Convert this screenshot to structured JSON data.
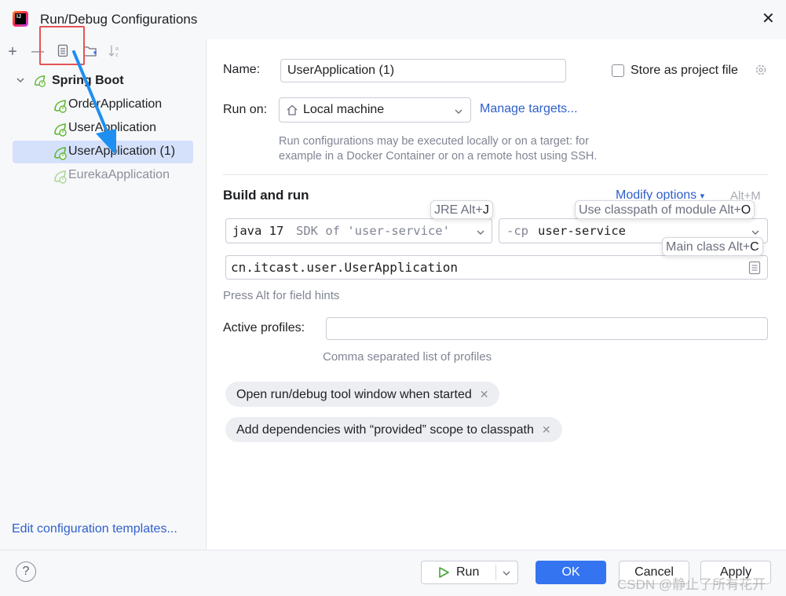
{
  "window": {
    "title": "Run/Debug Configurations",
    "close": "✕"
  },
  "toolbar": {
    "add": "+",
    "remove": "—",
    "copy": "▤",
    "folder": "🗀",
    "sort": "↓ᵃ"
  },
  "tree": {
    "group_label": "Spring Boot",
    "items": [
      {
        "label": "OrderApplication"
      },
      {
        "label": "UserApplication"
      },
      {
        "label": "UserApplication (1)"
      },
      {
        "label": "EurekaApplication"
      }
    ]
  },
  "left_footer": {
    "templates_link": "Edit configuration templates..."
  },
  "form": {
    "name_label": "Name:",
    "name_value": "UserApplication (1)",
    "store_label": "Store as project file",
    "run_on_label": "Run on:",
    "run_on_value": "Local machine",
    "manage_targets": "Manage targets...",
    "run_on_hint_1": "Run configurations may be executed locally or on a target: for",
    "run_on_hint_2": "example in a Docker Container or on a remote host using SSH.",
    "build_run_title": "Build and run",
    "modify_options": "Modify options",
    "modify_shortcut": "Alt+M",
    "jre_prefix": "java 17",
    "jre_suffix": "SDK of 'user-service'",
    "cp_prefix": "-cp",
    "cp_value": "user-service",
    "main_class": "cn.itcast.user.UserApplication",
    "field_hints": "Press Alt for field hints",
    "active_profiles_label": "Active profiles:",
    "active_profiles_value": "",
    "profiles_hint": "Comma separated list of profiles",
    "chip_1": "Open run/debug tool window when started",
    "chip_2": "Add dependencies with “provided” scope to classpath"
  },
  "tooltips": {
    "jre": "JRE Alt+",
    "jre_key": "J",
    "classpath": "Use classpath of module Alt+",
    "classpath_key": "O",
    "main_class": "Main class Alt+",
    "main_class_key": "C"
  },
  "footer": {
    "help": "?",
    "run": "Run",
    "ok": "OK",
    "cancel": "Cancel",
    "apply": "Apply"
  },
  "watermark": "CSDN @静止了所有花开",
  "colors": {
    "accent": "#3574f0",
    "highlight": "#e55454",
    "arrow": "#1e8ff0",
    "selection": "#d5e1fb"
  }
}
